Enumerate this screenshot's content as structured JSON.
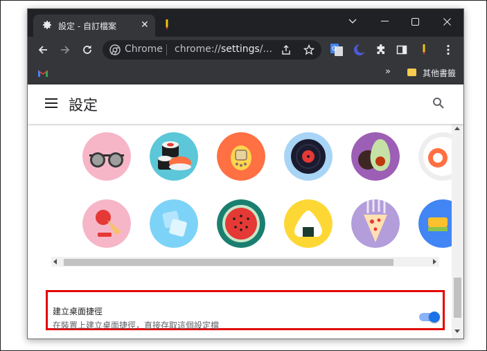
{
  "browser": {
    "tab": {
      "title": "設定 - 自訂檔案",
      "close_glyph": "✕"
    },
    "omnibox": {
      "site_label": "Chrome",
      "url_scheme": "chrome://",
      "url_host": "settings",
      "url_rest": "/..."
    },
    "bookmarks": {
      "more_glyph": "»",
      "folder_label": "其他書籤"
    }
  },
  "settings": {
    "page_title": "設定",
    "avatars_row1": [
      "sunglasses-avatar",
      "sushi-avatar",
      "tamagotchi-avatar",
      "vinyl-record-avatar",
      "avocado-avatar",
      "partial-avatar"
    ],
    "avatars_row2": [
      "ice-cream-avatar",
      "ice-cubes-avatar",
      "watermelon-avatar",
      "onigiri-avatar",
      "pizza-avatar",
      "partial-avatar"
    ],
    "shortcut": {
      "title": "建立桌面捷徑",
      "subtitle": "在裝置上建立桌面捷徑，直接存取這個設定檔",
      "enabled": true
    }
  },
  "colors": {
    "titlebar": "#202124",
    "toolbar": "#35363a",
    "toggle_on": "#1a73e8",
    "highlight_border": "#e30000"
  }
}
